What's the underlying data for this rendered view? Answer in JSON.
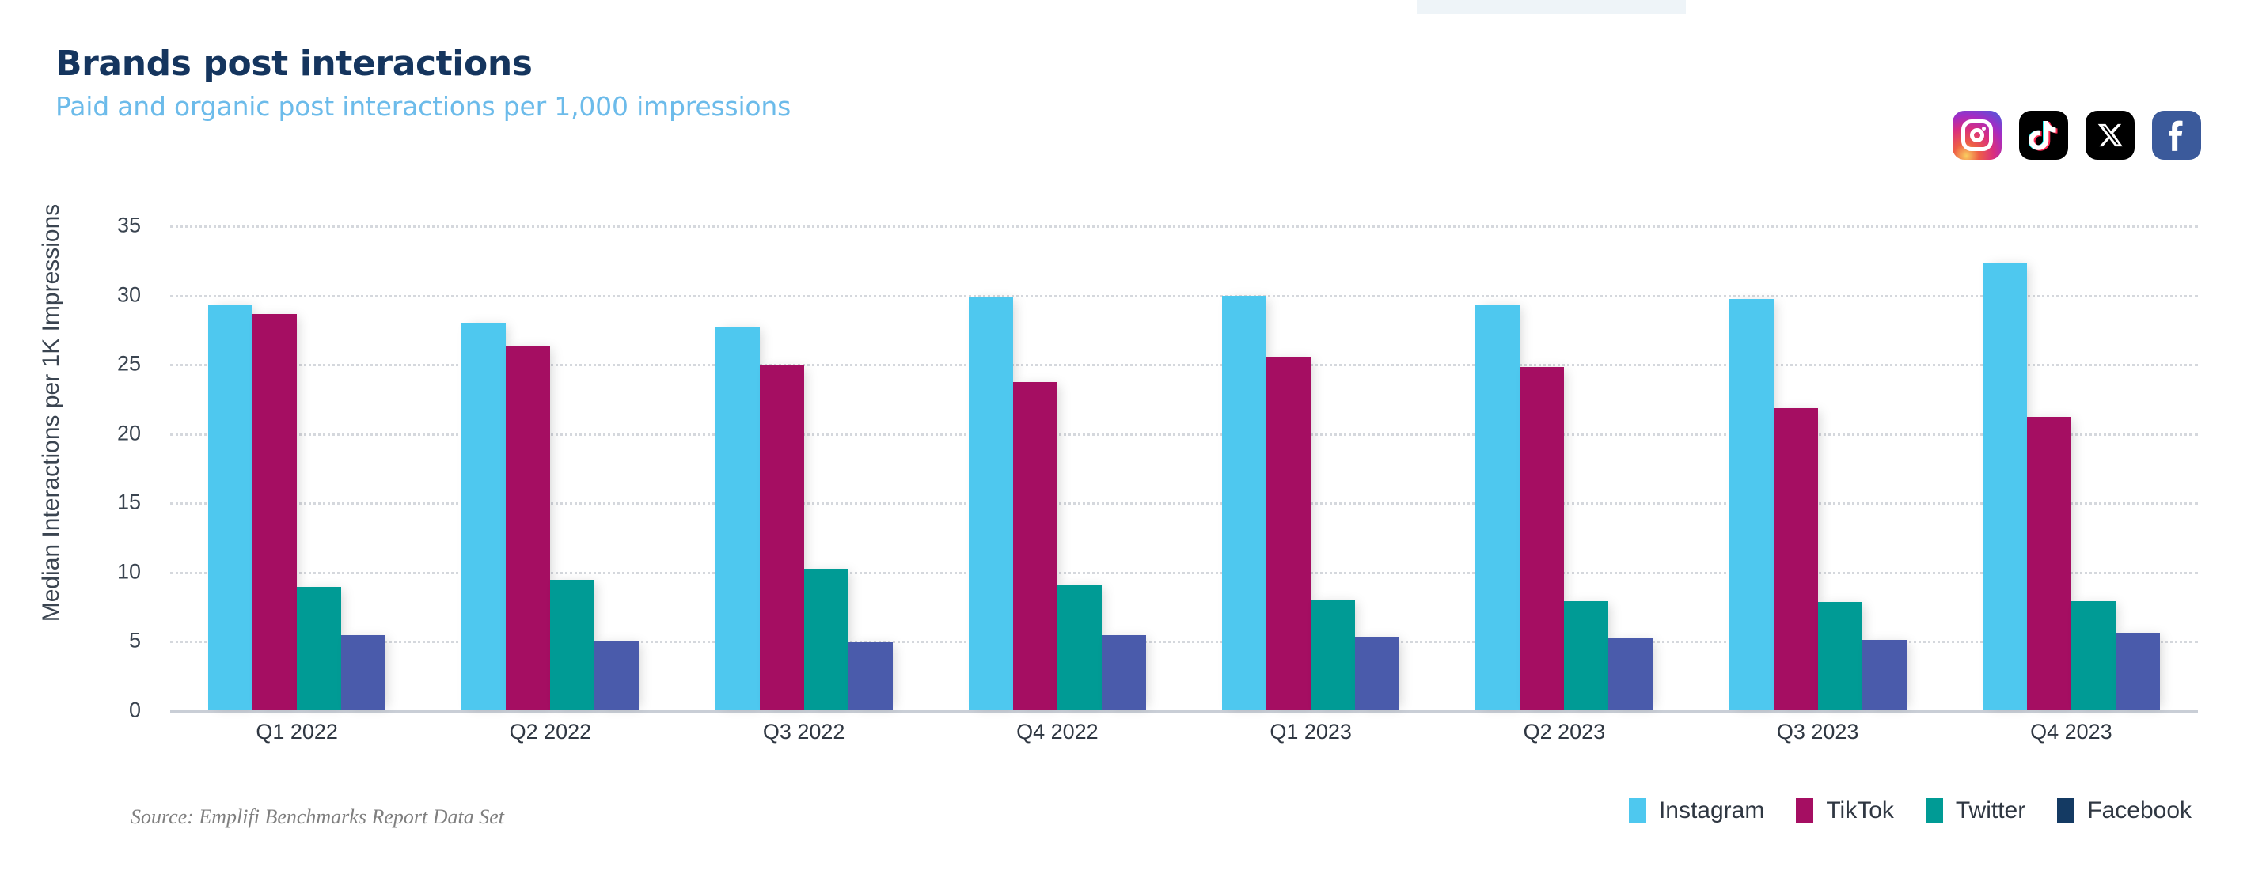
{
  "header": {
    "title": "Brands post interactions",
    "subtitle": "Paid and organic post interactions per 1,000 impressions",
    "title_color": "#15355e",
    "subtitle_color": "#6cbbea"
  },
  "social_icons": [
    {
      "name": "instagram-icon",
      "label": "Instagram"
    },
    {
      "name": "tiktok-icon",
      "label": "TikTok"
    },
    {
      "name": "x-icon",
      "label": "X"
    },
    {
      "name": "facebook-icon",
      "label": "Facebook"
    }
  ],
  "footer": {
    "source": "Source: Emplifi Benchmarks Report Data Set"
  },
  "legend": {
    "position": "bottom-right",
    "items": [
      {
        "label": "Instagram",
        "color": "#4ec8ef"
      },
      {
        "label": "TikTok",
        "color": "#a50e62"
      },
      {
        "label": "Twitter",
        "color": "#009b95"
      },
      {
        "label": "Facebook",
        "color": "#143a63"
      }
    ]
  },
  "chart_data": {
    "type": "bar",
    "title": "Brands post interactions",
    "subtitle": "Paid and organic post interactions per 1,000 impressions",
    "xlabel": "",
    "ylabel": "Median Interactions per 1K Impressions",
    "ylim": [
      0,
      35
    ],
    "yticks": [
      0,
      5,
      10,
      15,
      20,
      25,
      30,
      35
    ],
    "grid": true,
    "legend_position": "bottom-right",
    "categories": [
      "Q1 2022",
      "Q2 2022",
      "Q3 2022",
      "Q4 2022",
      "Q1 2023",
      "Q2 2023",
      "Q3 2023",
      "Q4 2023"
    ],
    "series": [
      {
        "name": "Instagram",
        "color": "#4ec8ef",
        "bar_color": "#4ec8ef",
        "values": [
          29.3,
          28.0,
          27.7,
          29.8,
          29.9,
          29.3,
          29.7,
          32.3
        ]
      },
      {
        "name": "TikTok",
        "color": "#a50e62",
        "bar_color": "#a50e62",
        "values": [
          28.6,
          26.3,
          24.9,
          23.7,
          25.5,
          24.8,
          21.8,
          21.2
        ]
      },
      {
        "name": "Twitter",
        "color": "#009b95",
        "bar_color": "#009b95",
        "values": [
          8.9,
          9.4,
          10.2,
          9.1,
          8.0,
          7.9,
          7.8,
          7.9
        ]
      },
      {
        "name": "Facebook",
        "color": "#143a63",
        "bar_color": "#4a5bab",
        "values": [
          5.4,
          5.0,
          4.9,
          5.4,
          5.3,
          5.2,
          5.1,
          5.6
        ]
      }
    ]
  }
}
